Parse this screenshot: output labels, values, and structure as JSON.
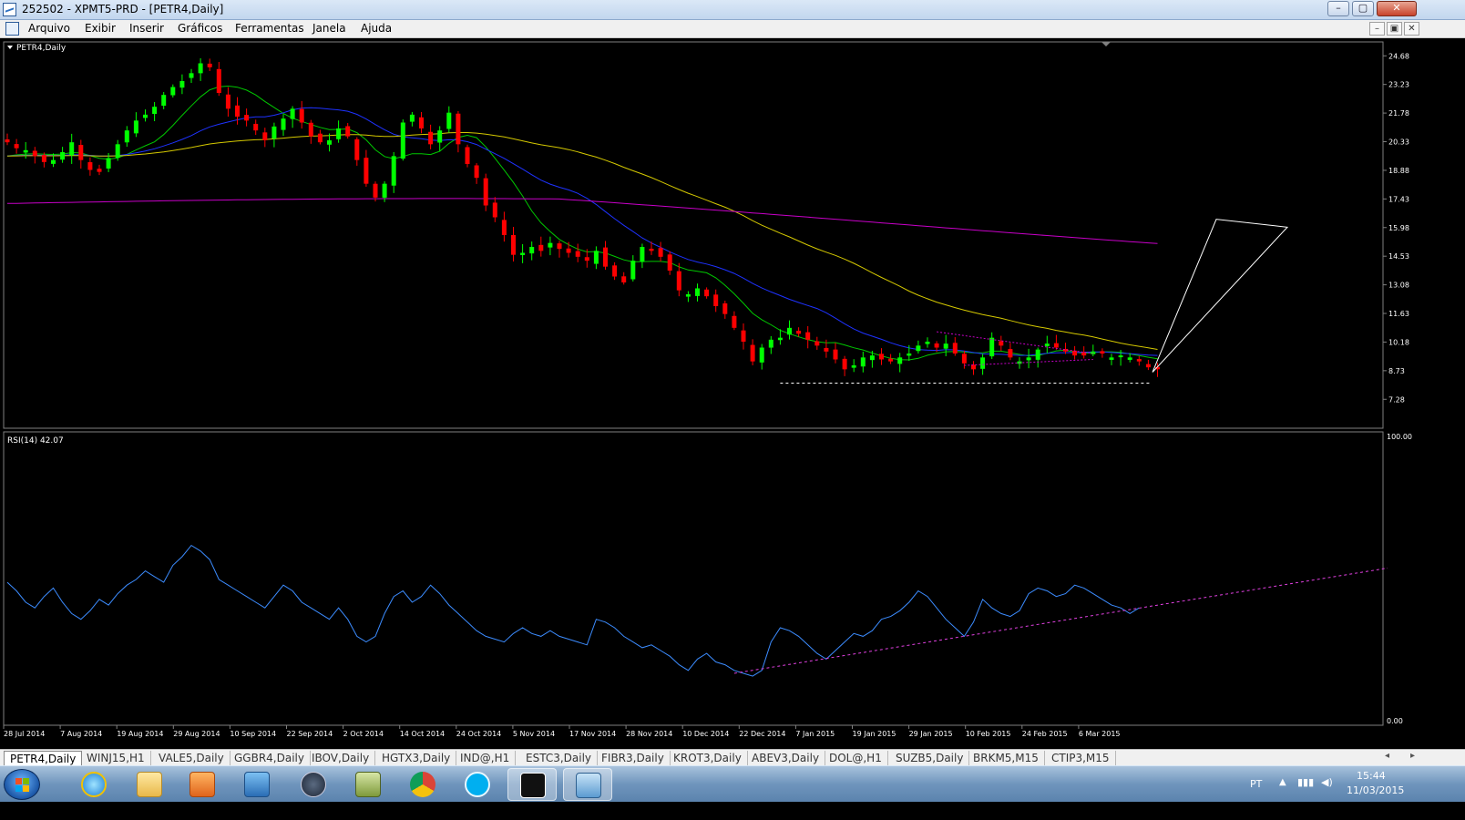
{
  "window": {
    "title": "252502 - XPMT5-PRD - [PETR4,Daily]",
    "minimize": "–",
    "maximize": "▢",
    "close": "✕"
  },
  "menu": [
    "Arquivo",
    "Exibir",
    "Inserir",
    "Gráficos",
    "Ferramentas",
    "Janela",
    "Ajuda"
  ],
  "mdi_controls": [
    "–",
    "▣",
    "✕"
  ],
  "main_panel": {
    "label": "PETR4,Daily",
    "y_ticks": [
      "24.68",
      "23.23",
      "21.78",
      "20.33",
      "18.88",
      "17.43",
      "15.98",
      "14.53",
      "13.08",
      "11.63",
      "10.18",
      "8.73",
      "7.28"
    ]
  },
  "rsi_panel": {
    "label": "RSI(14) 42.07",
    "y_ticks": [
      "100.00",
      "0.00"
    ]
  },
  "x_ticks": [
    "28 Jul 2014",
    "7 Aug 2014",
    "19 Aug 2014",
    "29 Aug 2014",
    "10 Sep 2014",
    "22 Sep 2014",
    "2 Oct 2014",
    "14 Oct 2014",
    "24 Oct 2014",
    "5 Nov 2014",
    "17 Nov 2014",
    "28 Nov 2014",
    "10 Dec 2014",
    "22 Dec 2014",
    "7 Jan 2015",
    "19 Jan 2015",
    "29 Jan 2015",
    "10 Feb 2015",
    "24 Feb 2015",
    "6 Mar 2015"
  ],
  "tabs": [
    "PETR4,Daily",
    "WINJ15,H1",
    "VALE5,Daily",
    "GGBR4,Daily",
    "IBOV,Daily",
    "HGTX3,Daily",
    "IND@,H1",
    "ESTC3,Daily",
    "FIBR3,Daily",
    "KROT3,Daily",
    "ABEV3,Daily",
    "DOL@,H1",
    "SUZB5,Daily",
    "BRKM5,M15",
    "CTIP3,M15"
  ],
  "active_tab": "PETR4,Daily",
  "taskbar": {
    "apps": [
      "internet-explorer-icon",
      "file-explorer-icon",
      "media-player-icon",
      "remote-desktop-icon",
      "hp-icon",
      "archive-icon",
      "chrome-icon",
      "skype-icon",
      "xp-icon",
      "metatrader-icon"
    ],
    "language": "PT",
    "time": "15:44",
    "date": "11/03/2015"
  },
  "colors": {
    "bull_candle": "#00ff00",
    "bear_candle": "#ff0000",
    "ma_fast": "#00c800",
    "ma_mid": "#1e32ff",
    "ma_slow": "#d4c800",
    "ma_long": "#c800c8",
    "rsi_line": "#3c8cff",
    "rsi_trendline": "#e040e0",
    "support_line": "#ffffff",
    "pattern_lines": "#ffffff"
  },
  "chart_data": {
    "type": "candlestick",
    "symbol": "PETR4",
    "timeframe": "Daily",
    "price_range": [
      6.0,
      25.2
    ],
    "closes": [
      20.3,
      20.0,
      19.9,
      19.6,
      19.3,
      19.4,
      19.8,
      20.3,
      19.4,
      18.9,
      18.8,
      19.5,
      20.2,
      20.9,
      21.4,
      21.7,
      22.1,
      22.7,
      23.1,
      23.4,
      23.8,
      24.3,
      24.1,
      22.8,
      22.0,
      21.6,
      21.4,
      20.9,
      20.4,
      21.1,
      21.5,
      22.0,
      21.3,
      20.6,
      20.3,
      20.4,
      21.0,
      20.6,
      19.4,
      18.2,
      17.5,
      18.2,
      19.6,
      21.3,
      21.7,
      21.0,
      20.2,
      20.9,
      21.8,
      20.2,
      19.2,
      18.5,
      17.1,
      16.5,
      15.6,
      14.6,
      14.7,
      15.0,
      14.8,
      15.2,
      14.9,
      14.7,
      14.5,
      14.3,
      14.8,
      14.0,
      13.5,
      13.2,
      14.3,
      15.0,
      14.8,
      14.5,
      13.8,
      12.8,
      12.6,
      12.9,
      12.5,
      12.0,
      11.6,
      10.9,
      10.2,
      9.2,
      9.9,
      10.3,
      10.4,
      10.9,
      10.6,
      10.3,
      10.0,
      9.7,
      9.3,
      8.8,
      9.0,
      9.4,
      9.5,
      9.3,
      9.2,
      9.4,
      9.6,
      10.0,
      10.2,
      9.9,
      10.1,
      9.6,
      9.1,
      8.8,
      9.4,
      10.4,
      10.0,
      9.4,
      9.2,
      9.4,
      9.8,
      10.1,
      9.9,
      9.7,
      9.5,
      9.5,
      9.7,
      9.6,
      9.4,
      9.5,
      9.4,
      9.2,
      8.9,
      8.8
    ],
    "moving_averages": [
      {
        "name": "fast",
        "period": 9
      },
      {
        "name": "mid",
        "period": 21
      },
      {
        "name": "slow",
        "period": 50
      },
      {
        "name": "long",
        "period": 200
      }
    ],
    "support_level": 8.1,
    "rsi": {
      "period": 14,
      "last": 42.07,
      "range": [
        0,
        100
      ],
      "values": [
        49,
        46,
        42,
        40,
        44,
        47,
        42,
        38,
        36,
        39,
        43,
        41,
        45,
        48,
        50,
        53,
        51,
        49,
        55,
        58,
        62,
        60,
        57,
        50,
        48,
        46,
        44,
        42,
        40,
        44,
        48,
        46,
        42,
        40,
        38,
        36,
        40,
        36,
        30,
        28,
        30,
        38,
        44,
        46,
        42,
        44,
        48,
        45,
        41,
        38,
        35,
        32,
        30,
        29,
        28,
        31,
        33,
        31,
        30,
        32,
        30,
        29,
        28,
        27,
        36,
        35,
        33,
        30,
        28,
        26,
        27,
        25,
        23,
        20,
        18,
        22,
        24,
        21,
        20,
        18,
        17,
        16,
        18,
        28,
        33,
        32,
        30,
        27,
        24,
        22,
        25,
        28,
        31,
        30,
        32,
        36,
        37,
        39,
        42,
        46,
        44,
        40,
        36,
        33,
        30,
        35,
        43,
        40,
        38,
        37,
        39,
        45,
        47,
        46,
        44,
        45,
        48,
        47,
        45,
        43,
        41,
        40,
        38,
        40
      ],
      "trendline_start": [
        79,
        17
      ],
      "trendline_end": [
        150,
        54
      ]
    }
  }
}
